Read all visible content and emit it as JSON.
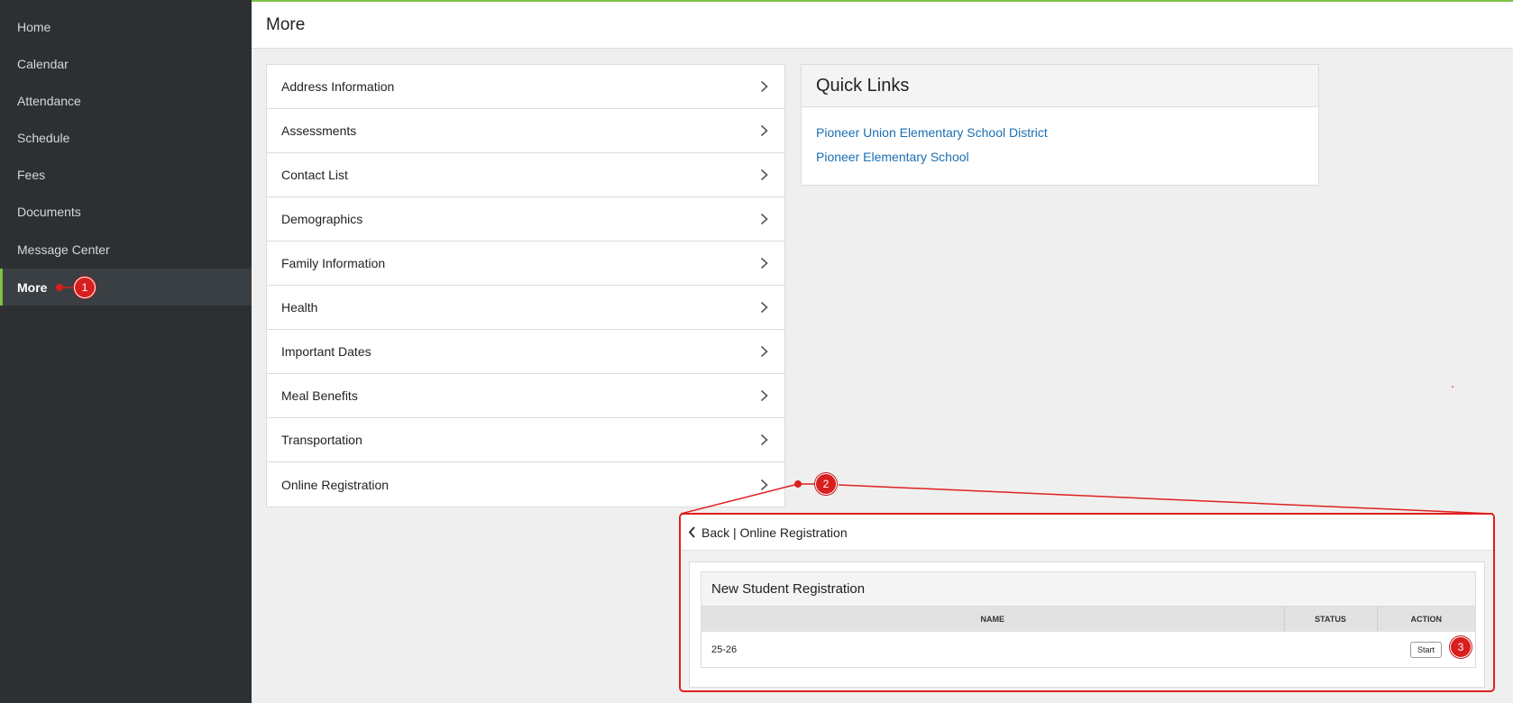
{
  "sidebar": {
    "items": [
      {
        "label": "Home"
      },
      {
        "label": "Calendar"
      },
      {
        "label": "Attendance"
      },
      {
        "label": "Schedule"
      },
      {
        "label": "Fees"
      },
      {
        "label": "Documents"
      },
      {
        "label": "Message Center"
      },
      {
        "label": "More"
      }
    ],
    "active": "More"
  },
  "header": {
    "title": "More"
  },
  "menu": {
    "items": [
      {
        "label": "Address Information"
      },
      {
        "label": "Assessments"
      },
      {
        "label": "Contact List"
      },
      {
        "label": "Demographics"
      },
      {
        "label": "Family Information"
      },
      {
        "label": "Health"
      },
      {
        "label": "Important Dates"
      },
      {
        "label": "Meal Benefits"
      },
      {
        "label": "Transportation"
      },
      {
        "label": "Online Registration"
      }
    ]
  },
  "quick_links": {
    "title": "Quick Links",
    "links": [
      {
        "label": "Pioneer Union Elementary School District"
      },
      {
        "label": "Pioneer Elementary School"
      }
    ]
  },
  "callout": {
    "back_label": "Back | Online Registration",
    "card_title": "New Student Registration",
    "columns": [
      "NAME",
      "STATUS",
      "ACTION"
    ],
    "rows": [
      {
        "name": "25-26",
        "status": "",
        "action": "Start"
      }
    ]
  },
  "annotations": [
    "1",
    "2",
    "3"
  ],
  "colors": {
    "accent": "#7dc243",
    "annotation": "#d81e1e",
    "link": "#1a6fb3",
    "sidebar": "#2c3033"
  }
}
